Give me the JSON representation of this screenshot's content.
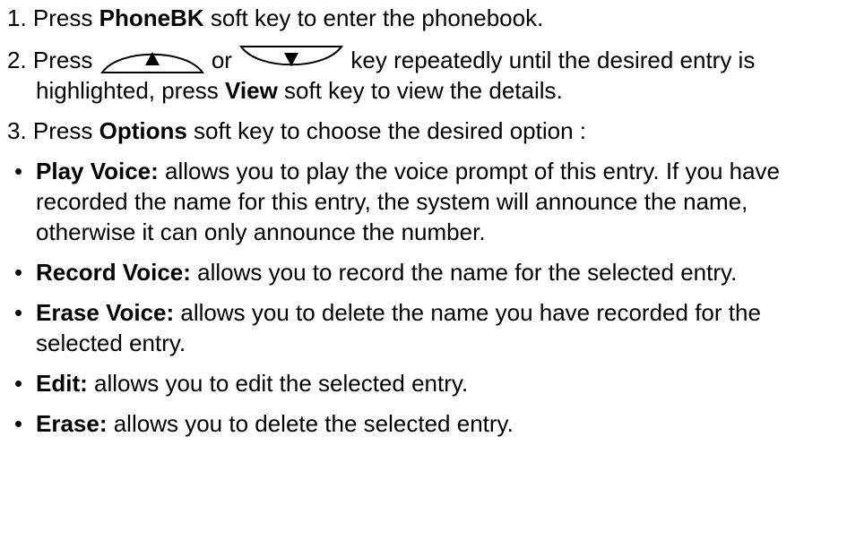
{
  "steps": [
    {
      "num": "1.",
      "pre": "Press ",
      "bold": "PhoneBK",
      "post": " soft key to enter the phonebook."
    },
    {
      "num": "2.",
      "pre": "Press ",
      "up_icon": "up-arrow-key-icon",
      "mid": " or ",
      "down_icon": "down-arrow-key-icon",
      "post1": "  key repeatedly until the desired entry is highlighted, press ",
      "bold": "View",
      "post2": " soft key to view the details."
    },
    {
      "num": "3.",
      "pre": "Press ",
      "bold": "Options",
      "post": " soft key to choose the desired option :"
    }
  ],
  "bullets": [
    {
      "title": "Play Voice:",
      "text": " allows you to play the voice prompt of this entry. If you have recorded the name for this entry, the system will announce the name, otherwise it can only announce the number."
    },
    {
      "title": "Record Voice:",
      "text": " allows you to record the name for the selected entry."
    },
    {
      "title": "Erase Voice:",
      "text": " allows you to delete the name you have recorded for the selected entry."
    },
    {
      "title": "Edit:",
      "text": " allows you to edit the selected entry."
    },
    {
      "title": "Erase:",
      "text": " allows you to delete the selected entry."
    }
  ],
  "bullet_char": "•"
}
